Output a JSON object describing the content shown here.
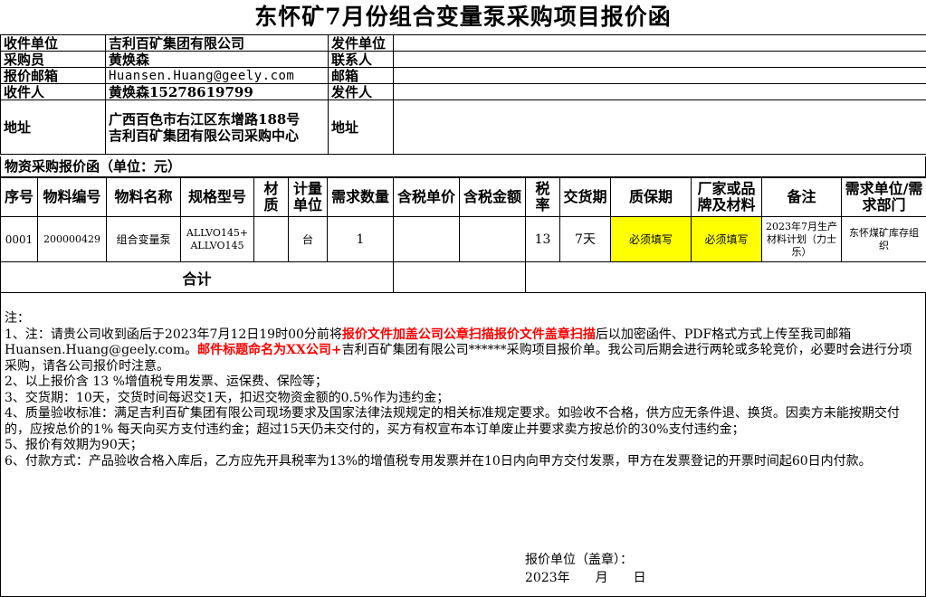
{
  "title": "东怀矿7月份组合变量泵采购项目报价函",
  "info": {
    "receiver_unit_label": "收件单位",
    "receiver_unit": "吉利百矿集团有限公司",
    "sender_unit_label": "发件单位",
    "sender_unit": "",
    "buyer_label": "采购员",
    "buyer": "黄焕森",
    "contact_label": "联系人",
    "contact": "",
    "quote_email_label": "报价邮箱",
    "quote_email": "Huansen.Huang@geely.com",
    "email_label": "邮箱",
    "email": "",
    "recipient_label": "收件人",
    "recipient": "黄焕森15278619799",
    "sender_label": "发件人",
    "sender": "",
    "address_label": "地址",
    "address_line1": "广西百色市右江区东增路188号",
    "address_line2": "吉利百矿集团有限公司采购中心",
    "address2_label": "地址",
    "address2": ""
  },
  "section_title": "物资采购报价函（单位：元）",
  "items": {
    "headers": [
      "序号",
      "物料编号",
      "物料名称",
      "规格型号",
      "材质",
      "计量单位",
      "需求数量",
      "含税单价",
      "含税金额",
      "税率",
      "交货期",
      "质保期",
      "厂家或品牌及材料",
      "备注",
      "需求单位/需求部门"
    ],
    "rows": [
      {
        "seq": "0001",
        "code": "200000429",
        "name": "组合变量泵",
        "spec": "ALLVO145+ALLVO145",
        "material": "",
        "unit": "台",
        "qty": "1",
        "unit_price": "",
        "amount": "",
        "tax_rate": "13",
        "delivery": "7天",
        "warranty": "必须填写",
        "brand": "必须填写",
        "remark": "2023年7月生产材料计划（力士乐）",
        "dept": "东怀煤矿库存组织"
      }
    ],
    "total_label": "合计"
  },
  "notes": {
    "heading": "注：",
    "n1_a": "1、注：请贵公司收到函后于2023年7月12日19时00分前将",
    "n1_red1": "报价文件加盖公司公章扫描报价文件盖章扫描",
    "n1_b": "后以加密函件、PDF格式方式上传至我司邮箱Huansen.Huang@geely.com。",
    "n1_red2": "邮件标题命名为XX公司+",
    "n1_c": "吉利百矿集团有限公司******采购项目报价单。我公司后期会进行两轮或多轮竞价，必要时会进行分项采购，请各公司报价时注意。",
    "n2": "2、以上报价含 13 %增值税专用发票、运保费、保险等；",
    "n3": "3、交货期：10天，交货时间每迟交1天，扣迟交物资金额的0.5%作为违约金；",
    "n4": "4、质量验收标准：满足吉利百矿集团有限公司现场要求及国家法律法规规定的相关标准规定要求。如验收不合格，供方应无条件退、换货。因卖方未能按期交付的，应按总价的1% 每天向买方支付违约金；超过15天仍未交付的，买方有权宣布本订单废止并要求卖方按总价的30%支付违约金；",
    "n5": "5、报价有效期为90天；",
    "n6": "6、付款方式：产品验收合格入库后，乙方应先开具税率为13%的增值税专用发票并在10日内向甲方交付发票，甲方在发票登记的开票时间起60日内付款。"
  },
  "sign": {
    "label": "报价单位（盖章）：",
    "date": "2023年　　月　　日"
  },
  "colors": {
    "must_fill_bg": "#ffff00",
    "red_text": "#ff0000"
  }
}
